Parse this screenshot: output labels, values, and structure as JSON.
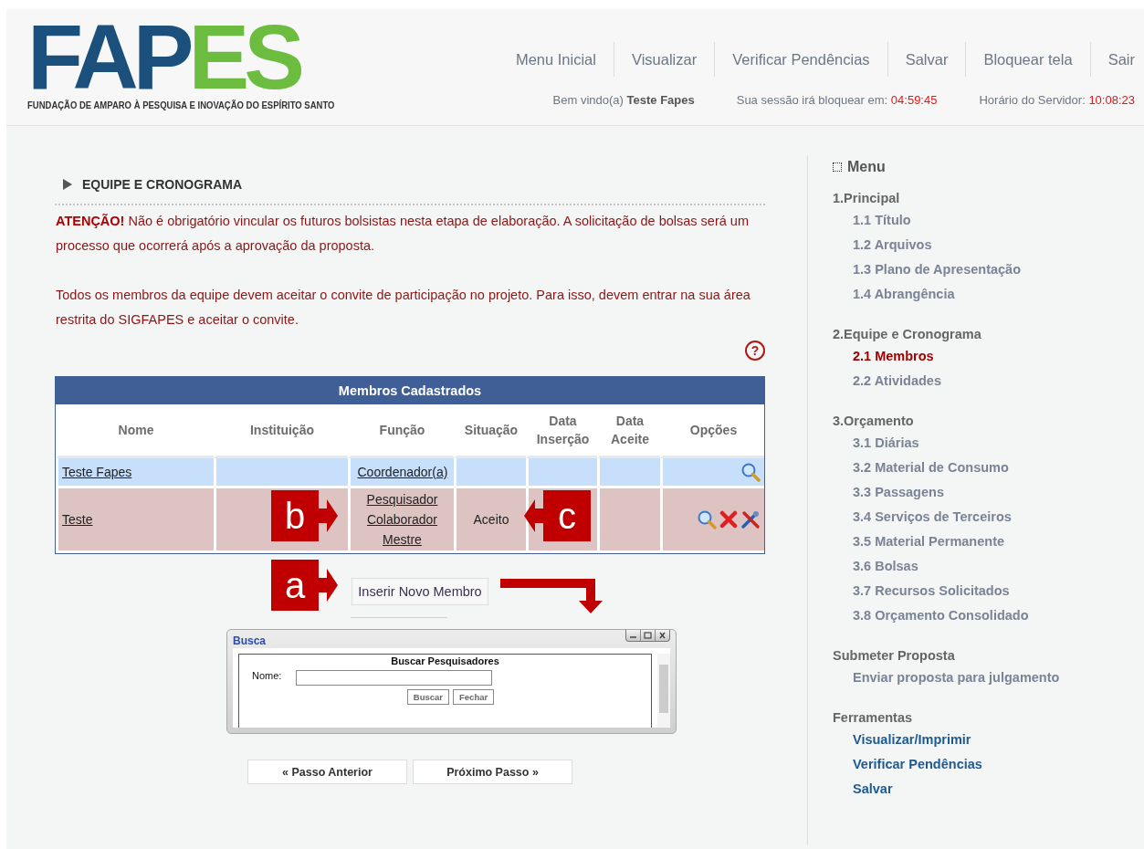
{
  "logo": {
    "parts": [
      {
        "text": "FAP",
        "color": "#1b4f7c"
      },
      {
        "text": "ES",
        "color": "#6cbd3f"
      }
    ],
    "subtitle": "FUNDAÇÃO DE AMPARO À PESQUISA E INOVAÇÃO DO ESPÍRITO SANTO"
  },
  "nav": [
    "Menu Inicial",
    "Visualizar",
    "Verificar Pendências",
    "Salvar",
    "Bloquear tela",
    "Sair"
  ],
  "status": {
    "welcome_label": "Bem vindo(a)",
    "user": "Teste Fapes",
    "session_label": "Sua sessão irá bloquear em:",
    "session_time": "04:59:45",
    "server_label": "Horário do Servidor:",
    "server_time": "10:08:23"
  },
  "section_title": "EQUIPE E CRONOGRAMA",
  "notices": [
    "**ATENÇÃO!** Não é obrigatório vincular os futuros bolsistas nesta etapa de elaboração. A solicitação de bolsas será um processo que ocorrerá após a aprovação da proposta.",
    "Todos os membros da equipe devem aceitar o convite de participação no projeto. Para isso, devem entrar na sua área restrita do SIGFAPES e aceitar o convite."
  ],
  "help": "?",
  "table": {
    "title": "Membros Cadastrados",
    "columns": [
      "Nome",
      "Instituição",
      "Função",
      "Situação",
      "Data Inserção",
      "Data Aceite",
      "Opções"
    ],
    "rows": [
      {
        "color": "#c7dffa",
        "nome": "Teste Fapes",
        "funcao": "Coordenador(a)",
        "situacao": "",
        "actions": [
          {
            "kind": "view"
          }
        ]
      },
      {
        "color": "#dec3c3",
        "nome": "Teste",
        "funcao": "Pesquisador Colaborador Mestre",
        "situacao": "Aceito",
        "actions": [
          {
            "kind": "view"
          },
          {
            "kind": "delete"
          },
          {
            "kind": "edit"
          }
        ]
      }
    ]
  },
  "insert_button": "Inserir Novo Membro",
  "dialog": {
    "title": "Busca",
    "heading": "Buscar Pesquisadores",
    "field_label": "Nome:",
    "buttons": [
      "Buscar",
      "Fechar"
    ]
  },
  "callouts": [
    {
      "label": "a",
      "kind": "right"
    },
    {
      "label": "b",
      "kind": "right"
    },
    {
      "label": "c",
      "kind": "left"
    }
  ],
  "step_buttons": [
    "« Passo Anterior",
    "Próximo Passo »"
  ],
  "sidebar": {
    "title": "Menu",
    "groups": [
      {
        "title": "1.Principal",
        "items": [
          {
            "label": "1.1 Título",
            "selected": false
          },
          {
            "label": "1.2 Arquivos",
            "selected": false
          },
          {
            "label": "1.3 Plano de Apresentação",
            "selected": false
          },
          {
            "label": "1.4 Abrangência",
            "selected": false
          }
        ]
      },
      {
        "title": "2.Equipe e Cronograma",
        "items": [
          {
            "label": "2.1 Membros",
            "selected": true
          },
          {
            "label": "2.2 Atividades",
            "selected": false
          }
        ]
      },
      {
        "title": "3.Orçamento",
        "items": [
          {
            "label": "3.1 Diárias",
            "selected": false
          },
          {
            "label": "3.2 Material de Consumo",
            "selected": false
          },
          {
            "label": "3.3 Passagens",
            "selected": false
          },
          {
            "label": "3.4 Serviços de Terceiros",
            "selected": false
          },
          {
            "label": "3.5 Material Permanente",
            "selected": false
          },
          {
            "label": "3.6 Bolsas",
            "selected": false
          },
          {
            "label": "3.7 Recursos Solicitados",
            "selected": false
          },
          {
            "label": "3.8 Orçamento Consolidado",
            "selected": false
          }
        ]
      },
      {
        "title": "Submeter Proposta",
        "items": [
          {
            "label": "Enviar proposta para julgamento",
            "selected": false
          }
        ]
      },
      {
        "title": "Ferramentas",
        "kind": "tools",
        "items": [
          {
            "label": "Visualizar/Imprimir",
            "selected": false
          },
          {
            "label": "Verificar Pendências",
            "selected": false
          },
          {
            "label": "Salvar",
            "selected": false
          }
        ]
      }
    ]
  }
}
